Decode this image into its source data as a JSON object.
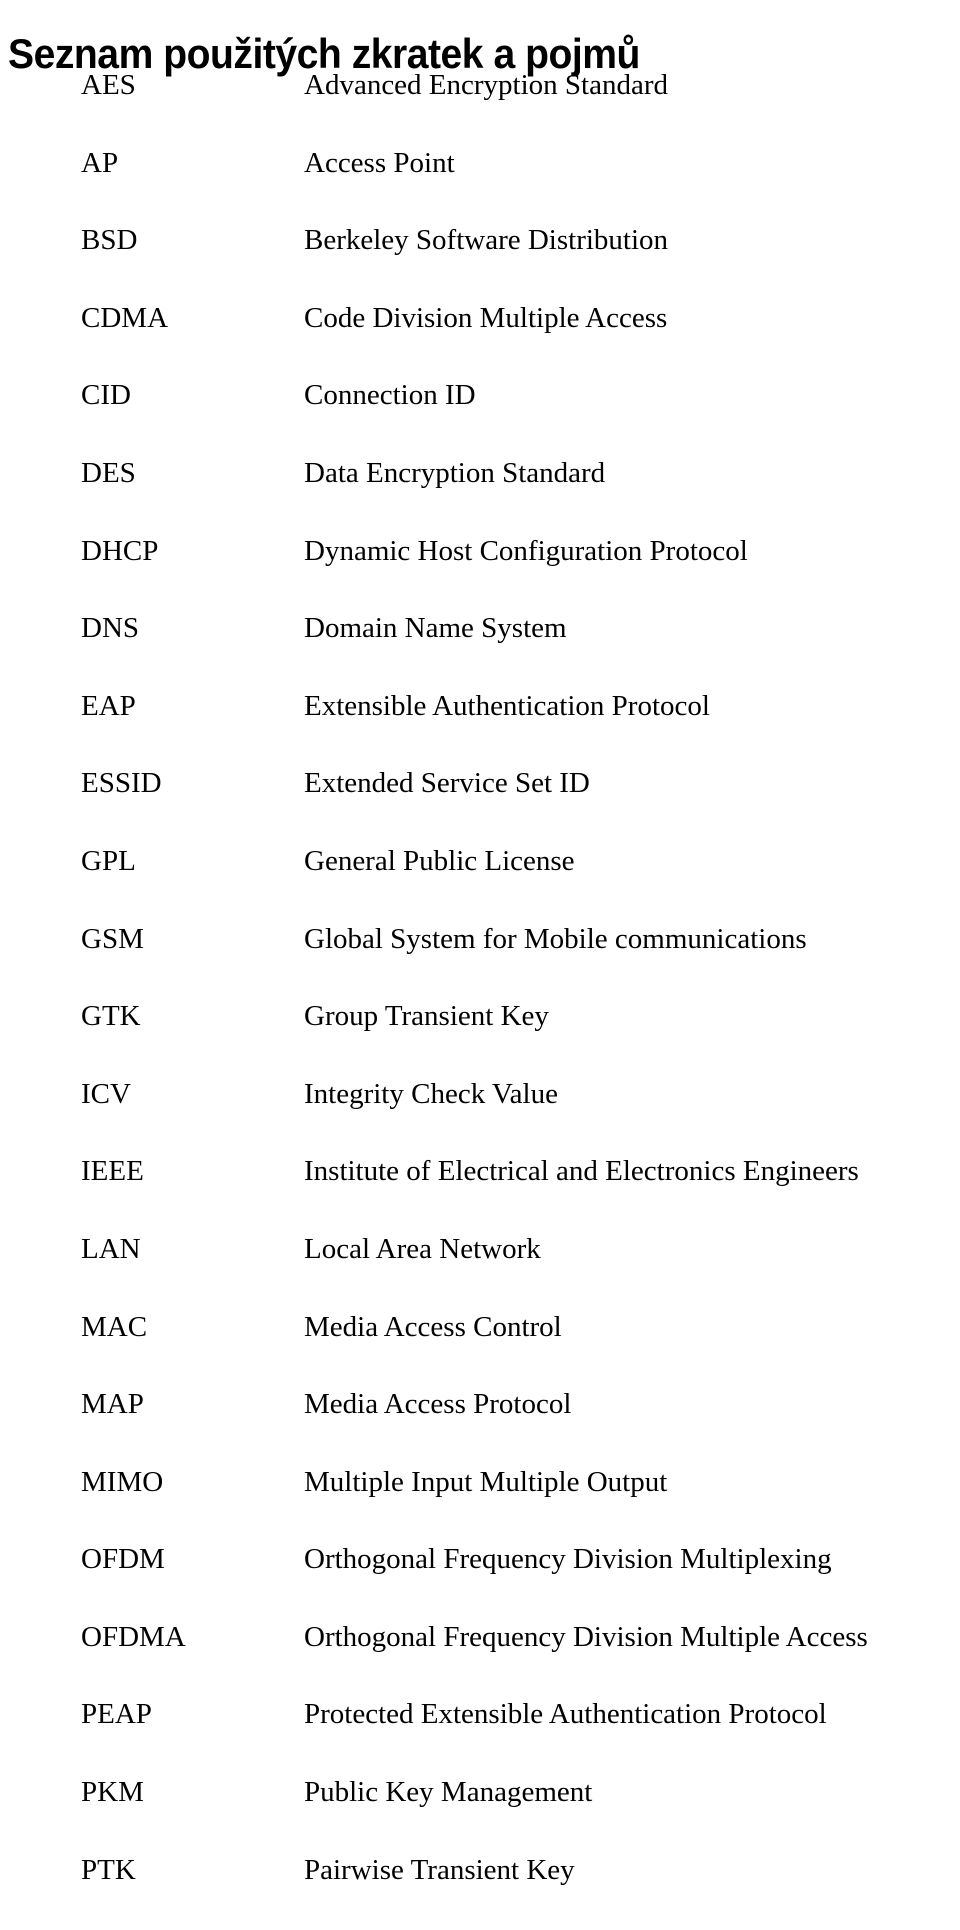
{
  "document": {
    "title": "Seznam použitých zkratek a pojmů",
    "language": "cs"
  },
  "abbreviations": {
    "term_column_header": "",
    "definition_column_header": "",
    "items": [
      {
        "term": "AES",
        "definition": "Advanced Encryption Standard"
      },
      {
        "term": "AP",
        "definition": "Access Point"
      },
      {
        "term": "BSD",
        "definition": "Berkeley Software Distribution"
      },
      {
        "term": "CDMA",
        "definition": "Code Division Multiple Access"
      },
      {
        "term": "CID",
        "definition": "Connection ID"
      },
      {
        "term": "DES",
        "definition": "Data Encryption Standard"
      },
      {
        "term": "DHCP",
        "definition": "Dynamic Host Configuration Protocol"
      },
      {
        "term": "DNS",
        "definition": "Domain Name System"
      },
      {
        "term": "EAP",
        "definition": "Extensible Authentication Protocol"
      },
      {
        "term": "ESSID",
        "definition": "Extended Service Set ID"
      },
      {
        "term": "GPL",
        "definition": "General Public License"
      },
      {
        "term": "GSM",
        "definition": "Global System for Mobile communications"
      },
      {
        "term": "GTK",
        "definition": "Group Transient Key"
      },
      {
        "term": "ICV",
        "definition": "Integrity Check Value"
      },
      {
        "term": "IEEE",
        "definition": "Institute of Electrical and Electronics Engineers"
      },
      {
        "term": "LAN",
        "definition": "Local Area Network"
      },
      {
        "term": "MAC",
        "definition": "Media Access Control"
      },
      {
        "term": "MAP",
        "definition": "Media Access Protocol"
      },
      {
        "term": "MIMO",
        "definition": "Multiple Input Multiple Output"
      },
      {
        "term": "OFDM",
        "definition": "Orthogonal Frequency Division Multiplexing"
      },
      {
        "term": "OFDMA",
        "definition": "Orthogonal Frequency Division Multiple Access"
      },
      {
        "term": "PEAP",
        "definition": "Protected Extensible Authentication Protocol"
      },
      {
        "term": "PKM",
        "definition": "Public Key Management"
      },
      {
        "term": "PTK",
        "definition": "Pairwise Transient Key"
      }
    ]
  },
  "colors": {
    "page_background": "#ffffff",
    "text": "#000000"
  }
}
